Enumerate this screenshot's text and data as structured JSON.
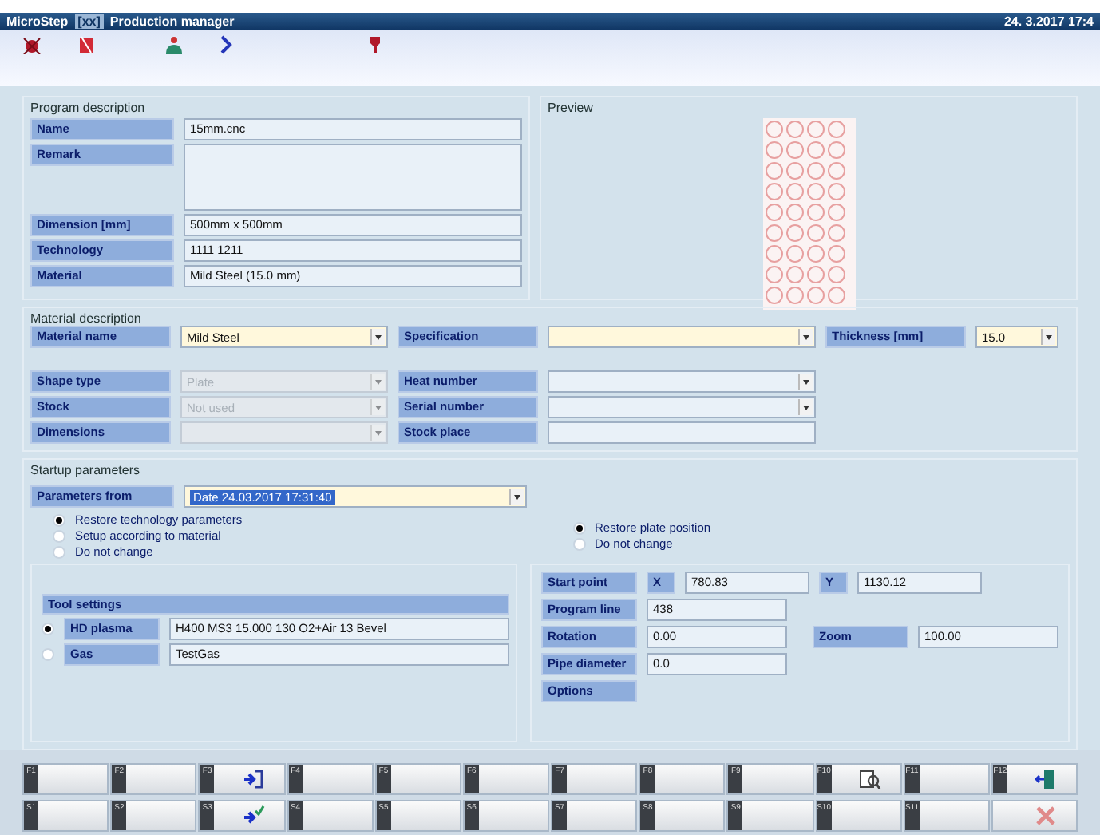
{
  "window": {
    "app": "MicroStep",
    "tag": "[xx]",
    "title": "Production manager",
    "datetime": "24. 3.2017 17:4"
  },
  "program_description": {
    "title": "Program description",
    "fields": [
      {
        "label": "Name",
        "value": "15mm.cnc",
        "kind": "text"
      },
      {
        "label": "Remark",
        "kind": "multiline"
      },
      {
        "label": "Dimension [mm]",
        "value": "500mm x 500mm",
        "kind": "text"
      },
      {
        "label": "Technology",
        "value": "1111 1211",
        "kind": "text"
      },
      {
        "label": "Material",
        "value": "Mild Steel (15.0 mm)",
        "kind": "text"
      }
    ]
  },
  "preview": {
    "title": "Preview"
  },
  "material_description": {
    "title": "Material description",
    "rows": [
      [
        {
          "label": "Material name",
          "value": "Mild Steel",
          "kind": "combo",
          "disabled": false,
          "highlight": true
        },
        {
          "label": "Specification",
          "kind": "combo",
          "disabled": false,
          "highlight": true
        },
        {
          "label": "Thickness [mm]",
          "value": "15.0",
          "kind": "combo",
          "disabled": false,
          "highlight": true
        }
      ],
      [
        {
          "label": "Shape type",
          "value": "Plate",
          "kind": "combo",
          "disabled": true,
          "highlight": false
        },
        {
          "label": "Heat number",
          "kind": "combo",
          "disabled": false,
          "highlight": false
        }
      ],
      [
        {
          "label": "Stock",
          "value": "Not used",
          "kind": "combo",
          "disabled": true,
          "highlight": false
        },
        {
          "label": "Serial number",
          "kind": "combo",
          "disabled": false,
          "highlight": false
        }
      ],
      [
        {
          "label": "Dimensions",
          "kind": "combo",
          "disabled": true,
          "highlight": false
        },
        {
          "label": "Stock place",
          "kind": "text",
          "disabled": false,
          "highlight": false
        }
      ]
    ]
  },
  "startup": {
    "title": "Startup parameters",
    "parameters_from": {
      "label": "Parameters from",
      "value": "Date 24.03.2017 17:31:40"
    },
    "technology_options": [
      {
        "label": "Restore technology parameters",
        "selected": true
      },
      {
        "label": "Setup according to material",
        "selected": false
      },
      {
        "label": "Do not change",
        "selected": false
      }
    ],
    "plate_options": [
      {
        "label": "Restore plate position",
        "selected": true
      },
      {
        "label": "Do not change",
        "selected": false
      }
    ],
    "tool_settings": {
      "title": "Tool settings",
      "tools": [
        {
          "label": "HD plasma",
          "value": "H400 MS3 15.000 130 O2+Air 13 Bevel",
          "selected": true
        },
        {
          "label": "Gas",
          "value": "TestGas",
          "selected": false
        }
      ]
    },
    "position": {
      "start_point": "Start point",
      "x_label": "X",
      "x_value": "780.83",
      "y_label": "Y",
      "y_value": "1130.12",
      "program_line_label": "Program line",
      "program_line": "438",
      "rotation_label": "Rotation",
      "rotation": "0.00",
      "zoom_label": "Zoom",
      "zoom": "100.00",
      "pipe_diameter_label": "Pipe diameter",
      "pipe_diameter": "0.0",
      "options": "Options"
    }
  },
  "function_keys": [
    [
      {
        "key": "F1"
      },
      {
        "key": "F2"
      },
      {
        "key": "F3"
      },
      {
        "key": "F4"
      },
      {
        "key": "F5"
      },
      {
        "key": "F6"
      },
      {
        "key": "F7"
      },
      {
        "key": "F8"
      },
      {
        "key": "F9"
      },
      {
        "key": "F10"
      },
      {
        "key": "F11"
      },
      {
        "key": "F12"
      }
    ],
    [
      {
        "key": "S1"
      },
      {
        "key": "S2"
      },
      {
        "key": "S3"
      },
      {
        "key": "S4"
      },
      {
        "key": "S5"
      },
      {
        "key": "S6"
      },
      {
        "key": "S7"
      },
      {
        "key": "S8"
      },
      {
        "key": "S9"
      },
      {
        "key": "S10"
      },
      {
        "key": "S11"
      }
    ]
  ]
}
